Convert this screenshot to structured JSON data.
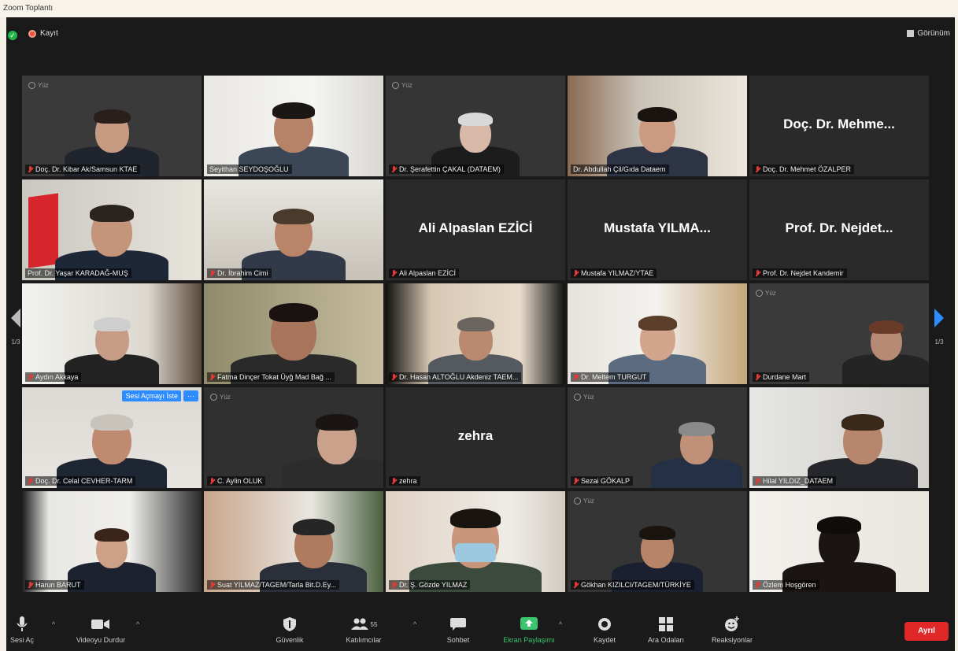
{
  "window": {
    "title": "Zoom Toplantı"
  },
  "topbar": {
    "recording_label": "Kayıt",
    "view_label": "Görünüm"
  },
  "page_indicator": {
    "left": "1/3",
    "right": "1/3"
  },
  "tiles": [
    {
      "name": "Doç. Dr. Kibar Ak/Samsun KTAE",
      "muted": true,
      "video": false,
      "sticker": "Yüz"
    },
    {
      "name": "Seyithan SEYDOŞOĞLU",
      "muted": false,
      "video": true
    },
    {
      "name": "Dr. Şerafettin ÇAKAL  (DATAEM)",
      "muted": true,
      "video": false,
      "sticker": "Yüz"
    },
    {
      "name": "Dr. Abdullah Çil/Gıda Dataem",
      "muted": false,
      "video": true,
      "active": true
    },
    {
      "name": "Doç. Dr. Mehmet ÖZALPER",
      "big_name": "Doç. Dr. Mehme...",
      "muted": true,
      "video": false
    },
    {
      "name": "Prof. Dr. Yaşar KARADAĞ-MUŞ",
      "muted": false,
      "video": true
    },
    {
      "name": "Dr. İbrahim Cimi",
      "muted": true,
      "video": true
    },
    {
      "name": "Ali Alpaslan EZİCİ",
      "big_name": "Ali Alpaslan EZİCİ",
      "muted": true,
      "video": false
    },
    {
      "name": "Mustafa YILMAZ/YTAE",
      "big_name": "Mustafa  YILMA...",
      "muted": true,
      "video": false
    },
    {
      "name": "Prof. Dr. Nejdet Kandemir",
      "big_name": "Prof. Dr. Nejdet...",
      "muted": true,
      "video": false
    },
    {
      "name": "Aydın Akkaya",
      "muted": true,
      "video": true
    },
    {
      "name": "Fatma Dinçer  Tokat Üyğ Mad Bağ ...",
      "muted": true,
      "video": true
    },
    {
      "name": "Dr. Hasan ALTOĞLU Akdeniz TAEM...",
      "muted": true,
      "video": true
    },
    {
      "name": "Dr. Meltem TURGUT",
      "muted": true,
      "video": true
    },
    {
      "name": "Durdane Mart",
      "muted": true,
      "video": false,
      "sticker": "Yüz"
    },
    {
      "name": "Doç. Dr. Celal CEVHER-TARM",
      "muted": true,
      "video": true,
      "hover": {
        "unmute_label": "Sesi Açmayı İste",
        "more_label": "···"
      }
    },
    {
      "name": "C. Aylin OLUK",
      "muted": true,
      "video": false,
      "sticker": "Yüz"
    },
    {
      "name": "zehra",
      "big_name": "zehra",
      "muted": true,
      "video": false
    },
    {
      "name": "Sezai GÖKALP",
      "muted": true,
      "video": false,
      "sticker": "Yüz"
    },
    {
      "name": "Hilal YILDIZ_DATAEM",
      "muted": true,
      "video": true
    },
    {
      "name": "Harun BARUT",
      "muted": true,
      "video": true
    },
    {
      "name": "Suat YILMAZ/TAGEM/Tarla Bit.D.Ey...",
      "muted": true,
      "video": true
    },
    {
      "name": "Dr. Ş. Gözde YILMAZ",
      "muted": true,
      "video": true
    },
    {
      "name": "Gökhan KIZILCI/TAGEM/TÜRKİYE",
      "muted": true,
      "video": false,
      "sticker": "Yüz"
    },
    {
      "name": "Özlem Hoşgören",
      "muted": true,
      "video": true
    }
  ],
  "toolbar": {
    "audio": "Sesi Aç",
    "video": "Videoyu Durdur",
    "security": "Güvenlik",
    "participants": "Katılımcılar",
    "participants_count": "55",
    "chat": "Sohbet",
    "share": "Ekran Paylaşımı",
    "record": "Kaydet",
    "breakout": "Ara Odaları",
    "reactions": "Reaksiyonlar",
    "leave": "Ayrıl"
  }
}
